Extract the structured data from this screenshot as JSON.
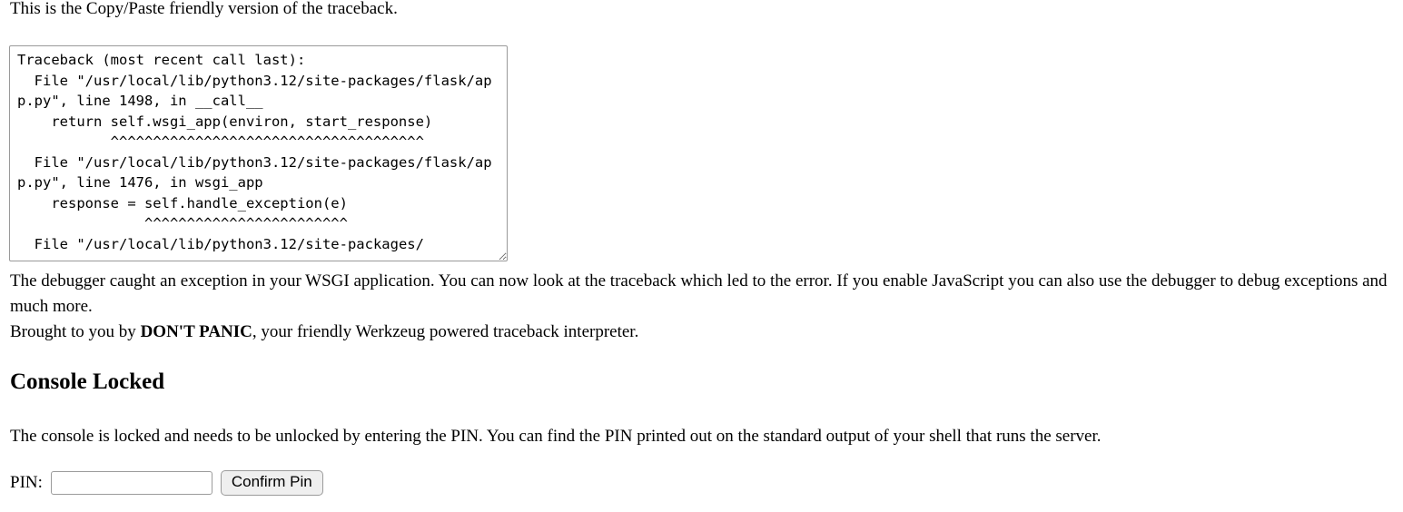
{
  "intro": {
    "text": "This is the Copy/Paste friendly version of the traceback."
  },
  "traceback": {
    "content": "Traceback (most recent call last):\n  File \"/usr/local/lib/python3.12/site-packages/flask/app.py\", line 1498, in __call__\n    return self.wsgi_app(environ, start_response)\n           ^^^^^^^^^^^^^^^^^^^^^^^^^^^^^^^^^^^^^\n  File \"/usr/local/lib/python3.12/site-packages/flask/app.py\", line 1476, in wsgi_app\n    response = self.handle_exception(e)\n               ^^^^^^^^^^^^^^^^^^^^^^^^\n  File \"/usr/local/lib/python3.12/site-packages/"
  },
  "description": {
    "line1": "The debugger caught an exception in your WSGI application. You can now look at the traceback which led to the error. If you enable JavaScript you can also use the debugger to debug exceptions and much more.",
    "line2_prefix": "Brought to you by ",
    "line2_brand": "DON'T PANIC",
    "line2_suffix": ", your friendly Werkzeug powered traceback interpreter."
  },
  "console": {
    "heading": "Console Locked",
    "locked_text": "The console is locked and needs to be unlocked by entering the PIN. You can find the PIN printed out on the standard output of your shell that runs the server.",
    "pin_label": "PIN:",
    "pin_value": "",
    "pin_placeholder": "",
    "confirm_label": "Confirm Pin"
  },
  "colors": {
    "background": "#ffffff",
    "text": "#000000",
    "border": "#9a9a9a",
    "button_face": "#efefef"
  }
}
